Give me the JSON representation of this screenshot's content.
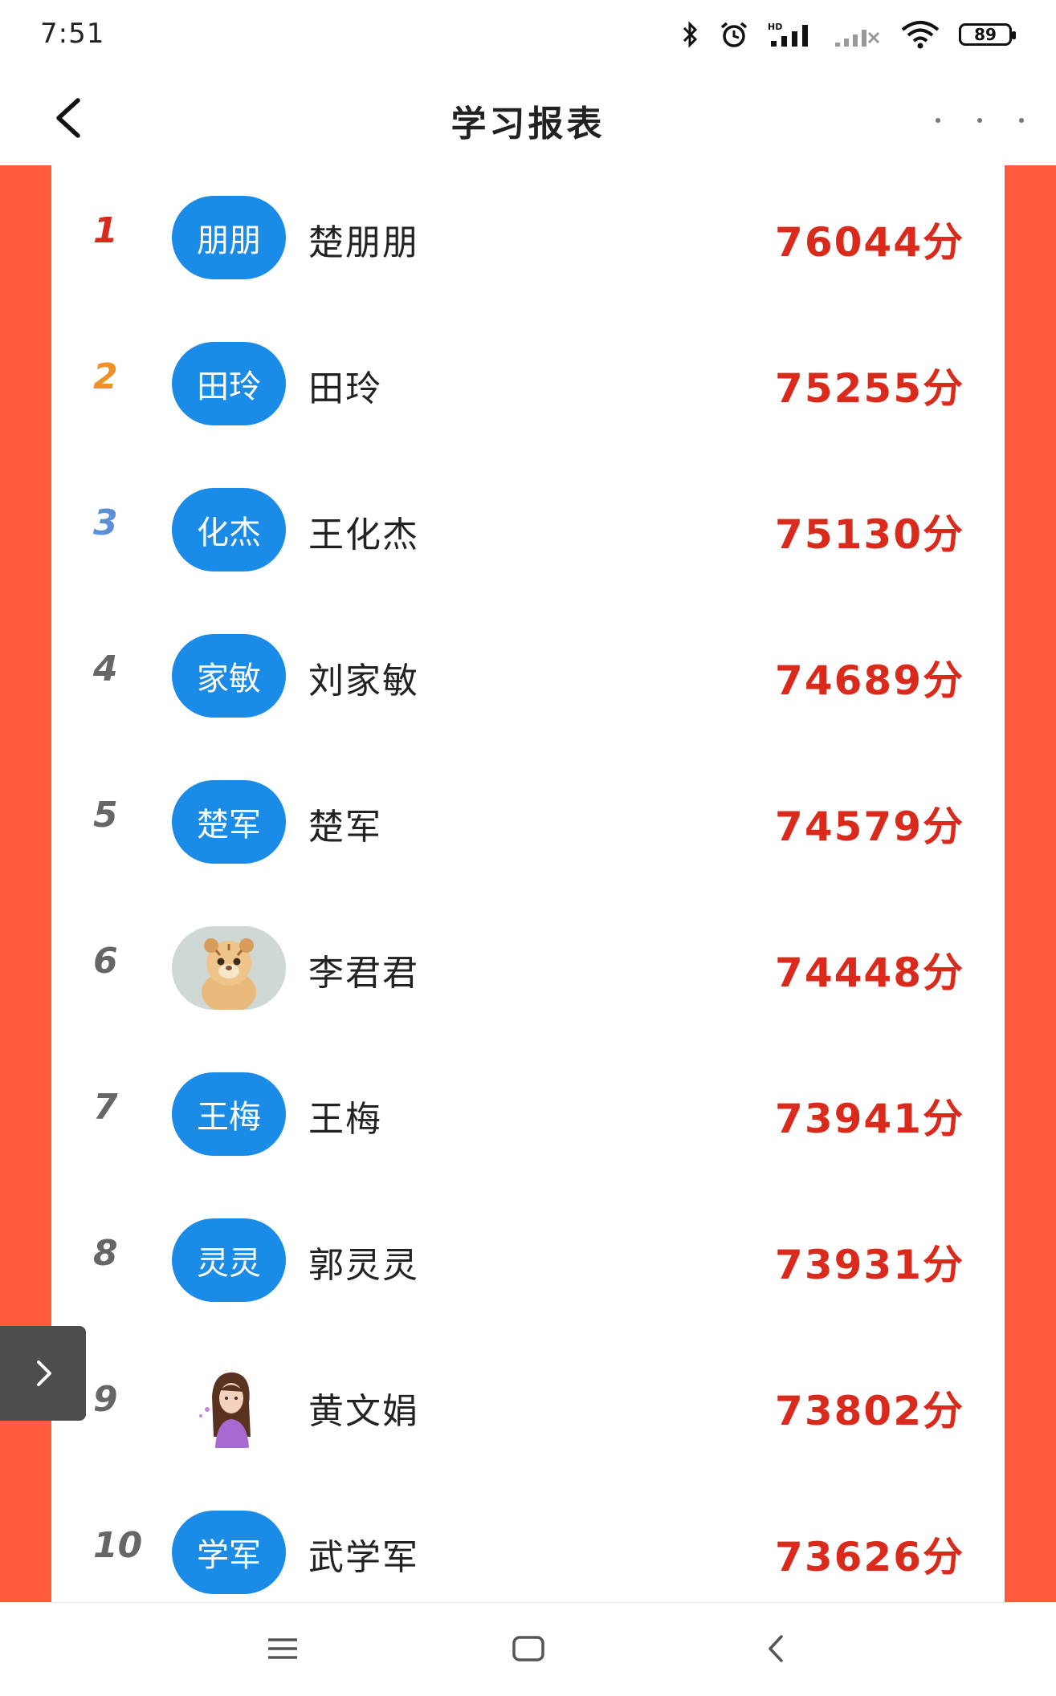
{
  "status_bar": {
    "time": "7:51",
    "battery": "89",
    "icons": [
      "bluetooth-icon",
      "alarm-icon",
      "hd-signal-icon",
      "signal-off-icon",
      "wifi-icon",
      "battery-icon"
    ]
  },
  "header": {
    "title": "学习报表",
    "back_icon": "chevron-left-icon",
    "more_icon": "more-dots-icon"
  },
  "colors": {
    "accent_red": "#ff5a3c",
    "score_red": "#d92a1c",
    "avatar_blue": "#1a8ce8",
    "rank_1": "#d92a1c",
    "rank_2": "#f0902a",
    "rank_3": "#5b8fd6",
    "rank_other": "#666666"
  },
  "ranking": [
    {
      "rank": "1",
      "avatar_text": "朋朋",
      "name": "楚朋朋",
      "score": "76044分"
    },
    {
      "rank": "2",
      "avatar_text": "田玲",
      "name": "田玲",
      "score": "75255分"
    },
    {
      "rank": "3",
      "avatar_text": "化杰",
      "name": "王化杰",
      "score": "75130分"
    },
    {
      "rank": "4",
      "avatar_text": "家敏",
      "name": "刘家敏",
      "score": "74689分"
    },
    {
      "rank": "5",
      "avatar_text": "楚军",
      "name": "楚军",
      "score": "74579分"
    },
    {
      "rank": "6",
      "avatar_text": "",
      "avatar_image": "tiger-cub-avatar",
      "name": "李君君",
      "score": "74448分"
    },
    {
      "rank": "7",
      "avatar_text": "王梅",
      "name": "王梅",
      "score": "73941分"
    },
    {
      "rank": "8",
      "avatar_text": "灵灵",
      "name": "郭灵灵",
      "score": "73931分"
    },
    {
      "rank": "9",
      "avatar_text": "",
      "avatar_image": "girl-cartoon-avatar",
      "name": "黄文娟",
      "score": "73802分"
    },
    {
      "rank": "10",
      "avatar_text": "学军",
      "name": "武学军",
      "score": "73626分"
    }
  ],
  "side_tab": {
    "icon": "chevron-right-icon"
  },
  "system_nav": {
    "icons": [
      "menu-icon",
      "home-square-icon",
      "back-icon"
    ]
  }
}
